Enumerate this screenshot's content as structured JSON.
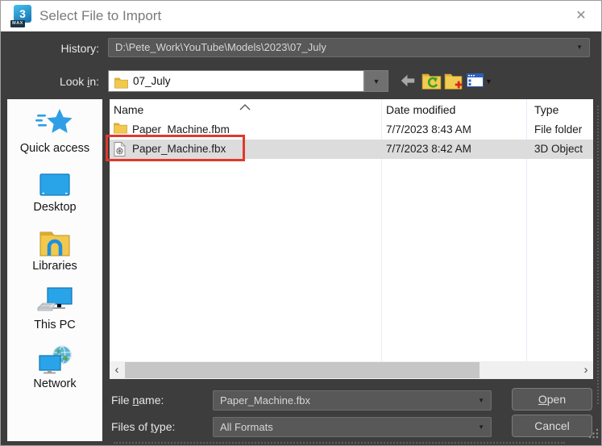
{
  "titlebar": {
    "title": "Select File to Import",
    "icon_number": "3",
    "icon_badge": "MAX",
    "close_glyph": "✕"
  },
  "history": {
    "label": "History:",
    "value": "D:\\Pete_Work\\YouTube\\Models\\2023\\07_July"
  },
  "look_in": {
    "label_parts": [
      "Look ",
      "i",
      "n:"
    ],
    "value": "07_July"
  },
  "toolbar": {
    "icons": [
      "go-back",
      "up-one-level",
      "create-new-folder",
      "view-menu"
    ],
    "view_menu_caret": "▼"
  },
  "sidebar": {
    "items": [
      {
        "label": "Quick access",
        "icon": "quick-access-star"
      },
      {
        "label": "Desktop",
        "icon": "desktop-monitor"
      },
      {
        "label": "Libraries",
        "icon": "libraries-folder"
      },
      {
        "label": "This PC",
        "icon": "this-pc"
      },
      {
        "label": "Network",
        "icon": "network-globe"
      }
    ]
  },
  "file_list": {
    "columns": [
      "Name",
      "Date modified",
      "Type"
    ],
    "sort": "ascending",
    "rows": [
      {
        "icon": "folder",
        "name": "Paper_Machine.fbm",
        "date_modified": "7/7/2023 8:43 AM",
        "type": "File folder",
        "selected": false
      },
      {
        "icon": "fbx-3d-object",
        "name": "Paper_Machine.fbx",
        "date_modified": "7/7/2023 8:42 AM",
        "type": "3D Object",
        "selected": true,
        "annotated": true
      }
    ]
  },
  "footer": {
    "file_name_label_parts": [
      "File ",
      "n",
      "ame:"
    ],
    "file_name_value": "Paper_Machine.fbx",
    "files_of_type_label_parts": [
      "Files of ",
      "t",
      "ype:"
    ],
    "files_of_type_value": "All Formats",
    "open_label_parts": [
      "O",
      "pen"
    ],
    "cancel_label": "Cancel"
  },
  "ui": {
    "dropdown_glyph": "▼",
    "scroll_left_glyph": "‹",
    "scroll_right_glyph": "›"
  },
  "colors": {
    "dialog_bg": "#3d3d3d",
    "field_bg": "#585858",
    "selection_gray": "#dcdcdc",
    "annotation_red": "#e0392b",
    "folder_yellow": "#f2c94c",
    "accent_blue": "#2e9fe6"
  }
}
